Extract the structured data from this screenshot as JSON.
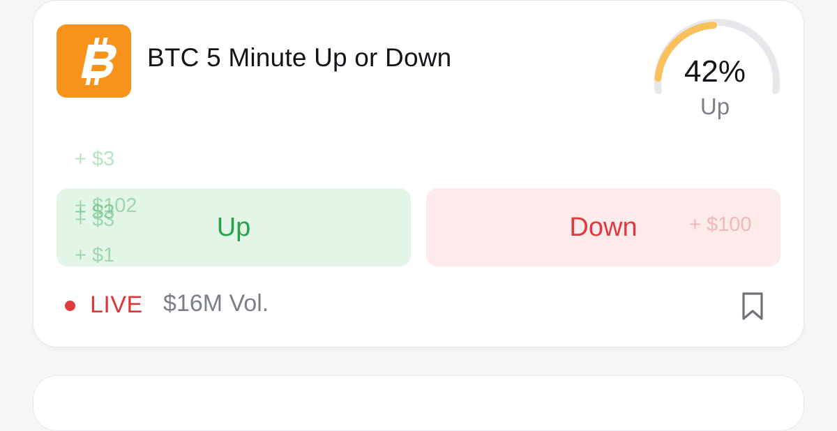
{
  "market": {
    "icon": "bitcoin-icon",
    "title": "BTC 5 Minute Up or Down",
    "probability": {
      "percent_label": "42%",
      "value": 0.42,
      "outcome_label": "Up",
      "color": "#f9c05c"
    }
  },
  "buttons": {
    "up_label": "Up",
    "down_label": "Down"
  },
  "floating_trades": {
    "up": [
      "+ $3",
      "+ $102",
      "+ $3",
      "+ $3",
      "+ $1"
    ],
    "down": [
      "+ $100"
    ]
  },
  "footer": {
    "live_label": "LIVE",
    "volume": "$16M Vol.",
    "bookmark_icon": "bookmark-icon"
  },
  "colors": {
    "brand_bitcoin": "#f7931a",
    "up_green": "#27a24c",
    "down_red": "#de3a3f",
    "live_red": "#d9373c"
  }
}
